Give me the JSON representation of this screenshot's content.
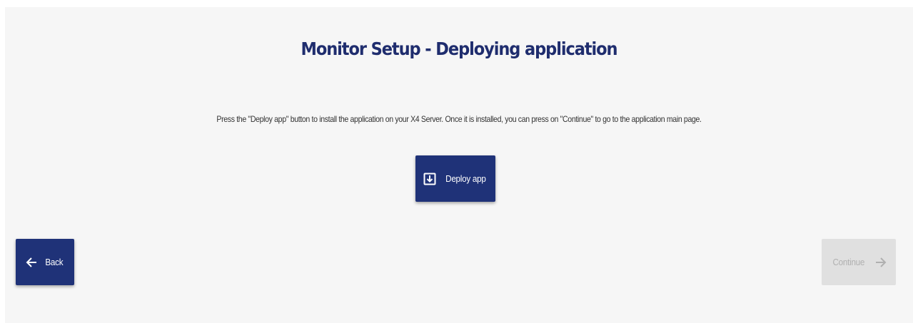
{
  "header": {
    "title": "Monitor Setup - Deploying application"
  },
  "main": {
    "instructions": "Press the \"Deploy app\" button to install the application on your X4 Server. Once it is installed, you can press on \"Continue\" to go to the application main page.",
    "deploy_button": {
      "label": "Deploy app",
      "icon": "download-box-icon"
    }
  },
  "footer": {
    "back_button": {
      "label": "Back",
      "icon": "arrow-left-icon"
    },
    "continue_button": {
      "label": "Continue",
      "icon": "arrow-right-icon",
      "disabled": true
    }
  },
  "colors": {
    "accent": "#1f3278",
    "title": "#1f2d6e",
    "background": "#f6f6f6",
    "disabled_bg": "#e0e0e0",
    "disabled_text": "#b0b0b0"
  }
}
